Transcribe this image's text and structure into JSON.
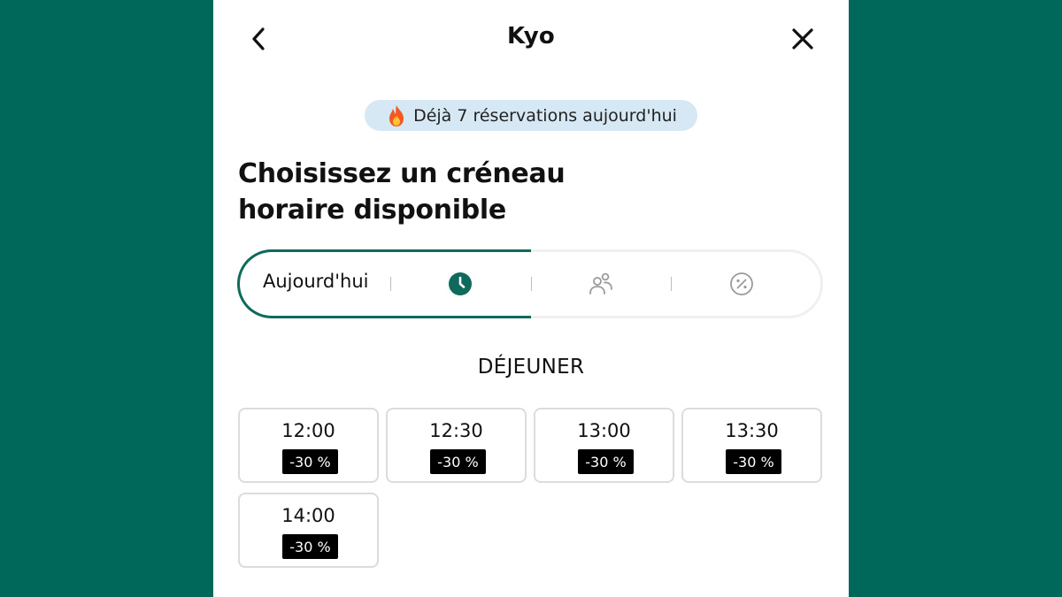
{
  "colors": {
    "background": "#00685A",
    "accent": "#0D6A5C",
    "badge_bg": "#D5E8F3",
    "discount_bg": "#000000"
  },
  "header": {
    "title": "Kyo",
    "back_icon": "chevron-left-icon",
    "close_icon": "close-icon"
  },
  "banner": {
    "icon": "flame-icon",
    "text": "Déjà 7 réservations aujourd'hui"
  },
  "heading": {
    "line1": "Choisissez un créneau",
    "line2": "horaire disponible"
  },
  "steps": {
    "date_label": "Aujourd'hui",
    "icons": [
      "clock-icon",
      "people-icon",
      "percent-icon"
    ],
    "active_step": "time"
  },
  "section": {
    "title": "DÉJEUNER"
  },
  "slots": [
    {
      "time": "12:00",
      "discount": "-30 %"
    },
    {
      "time": "12:30",
      "discount": "-30 %"
    },
    {
      "time": "13:00",
      "discount": "-30 %"
    },
    {
      "time": "13:30",
      "discount": "-30 %"
    },
    {
      "time": "14:00",
      "discount": "-30 %"
    }
  ]
}
